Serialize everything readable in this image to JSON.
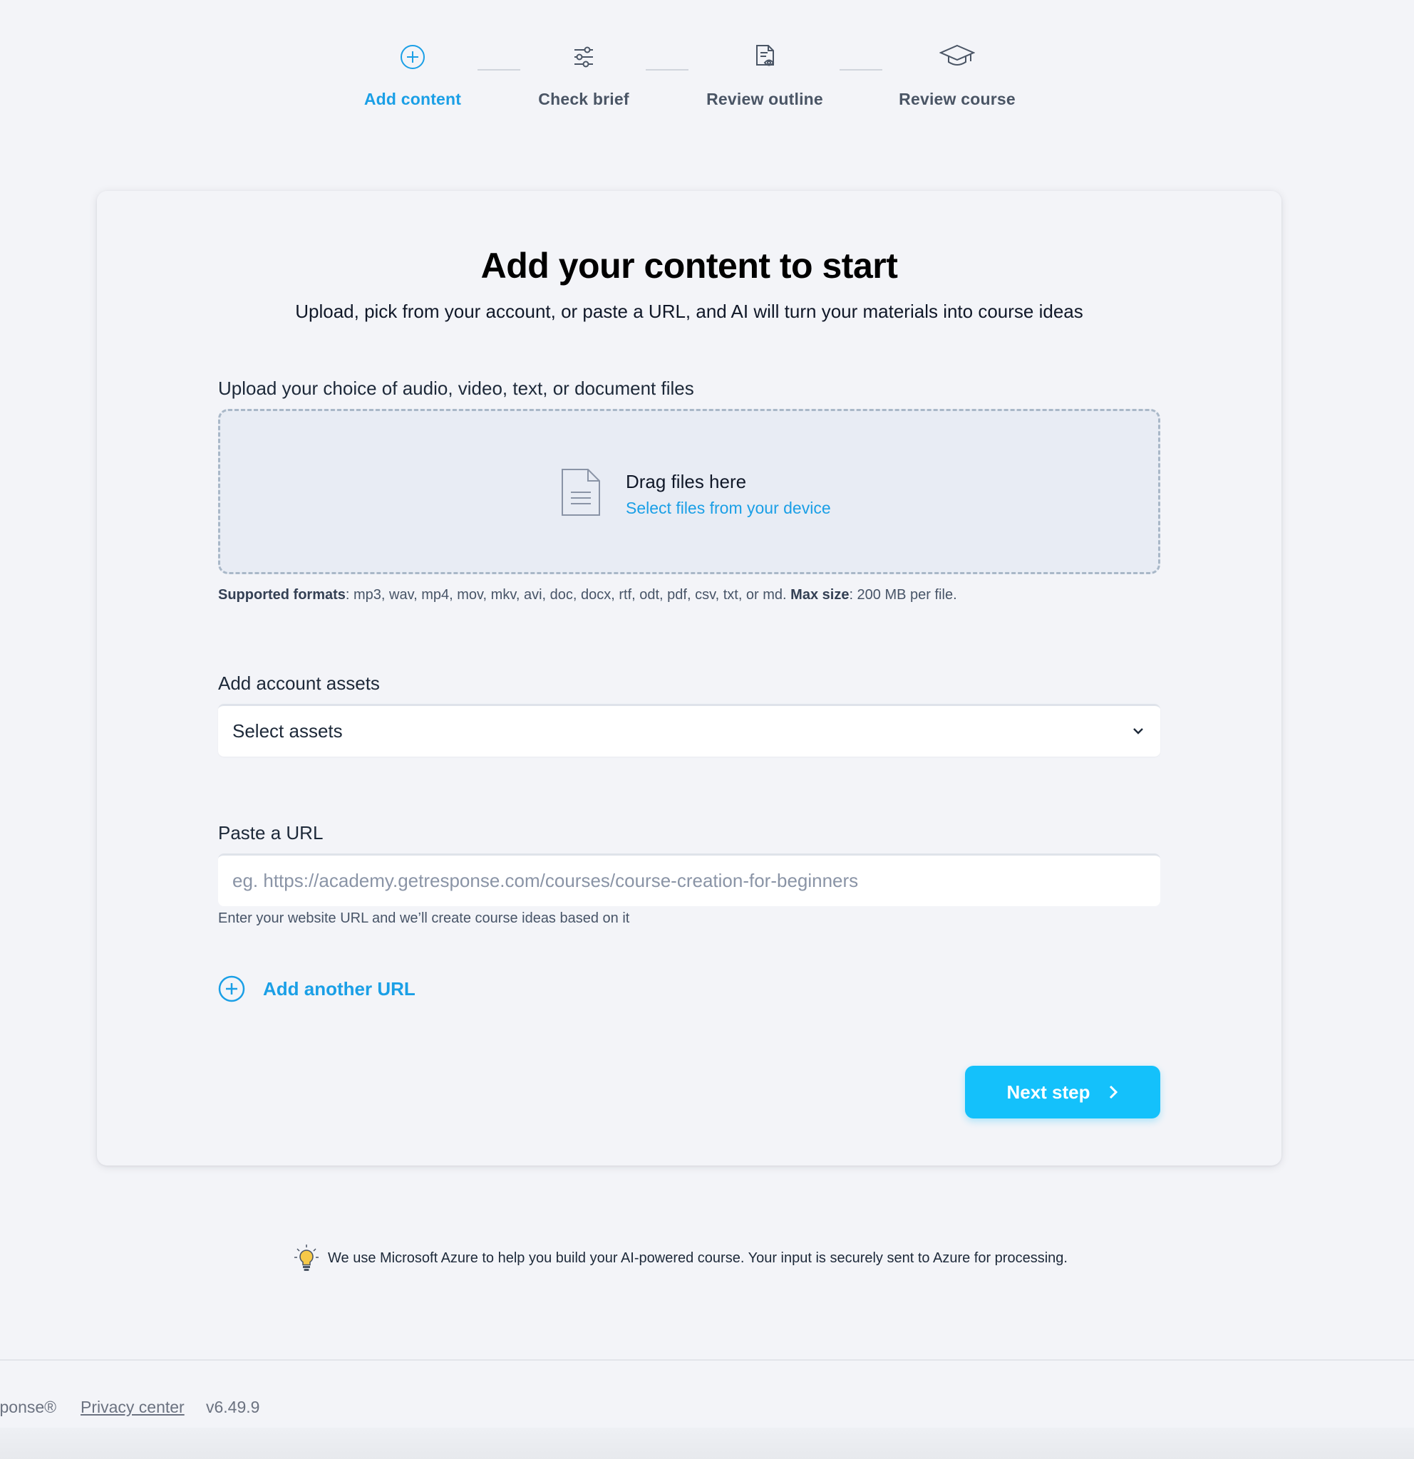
{
  "stepper": {
    "steps": [
      {
        "label": "Add content",
        "icon": "add-circle-icon",
        "active": true
      },
      {
        "label": "Check brief",
        "icon": "sliders-icon",
        "active": false
      },
      {
        "label": "Review outline",
        "icon": "document-eye-icon",
        "active": false
      },
      {
        "label": "Review course",
        "icon": "graduation-cap-icon",
        "active": false
      }
    ]
  },
  "card": {
    "title": "Add your content to start",
    "subtitle": "Upload, pick from your account, or paste a URL, and AI will turn your materials into course ideas",
    "upload": {
      "label": "Upload your choice of audio, video, text, or document files",
      "drag_text": "Drag files here",
      "select_link": "Select files from your device",
      "formats_label": "Supported formats",
      "formats_value": ": mp3, wav, mp4, mov, mkv, avi, doc, docx, rtf, odt, pdf, csv, txt, or md.",
      "max_size_label": "Max size",
      "max_size_value": ": 200 MB per file."
    },
    "assets": {
      "label": "Add account assets",
      "selected": "Select assets"
    },
    "url": {
      "label": "Paste a URL",
      "placeholder": "eg. https://academy.getresponse.com/courses/course-creation-for-beginners",
      "help": "Enter your website URL and we’ll create course ideas based on it",
      "add_another": "Add another URL"
    },
    "next_button": "Next step"
  },
  "notice": {
    "text": "We use Microsoft Azure to help you build your AI-powered course. Your input is securely sent to Azure for processing."
  },
  "footer": {
    "brand": "sponse®",
    "privacy": "Privacy center",
    "version": "v6.49.9"
  },
  "colors": {
    "accent": "#1a9fe6",
    "button": "#14c1fb",
    "background": "#f3f4f8"
  }
}
